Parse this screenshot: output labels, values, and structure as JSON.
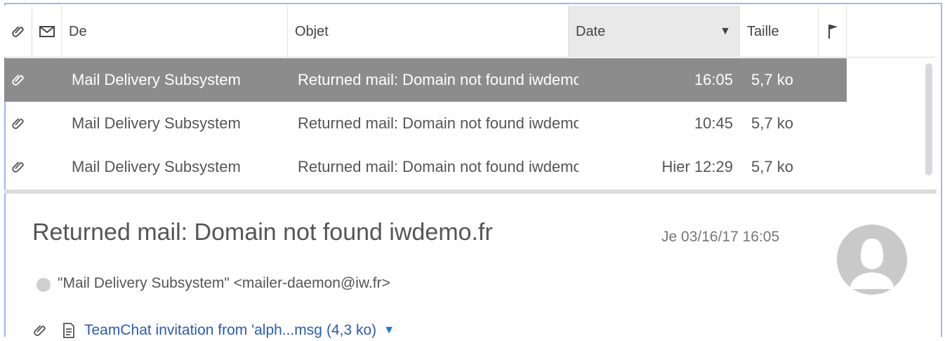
{
  "columns": {
    "from": "De",
    "subject": "Objet",
    "date": "Date",
    "sort_indicator": "▼",
    "size": "Taille"
  },
  "messages": [
    {
      "from": "Mail Delivery Subsystem",
      "subject": "Returned mail: Domain not found iwdemo.fr",
      "date": "16:05",
      "size": "5,7 ko",
      "selected": true,
      "has_attachment": true
    },
    {
      "from": "Mail Delivery Subsystem",
      "subject": "Returned mail: Domain not found iwdemo.fr",
      "date": "10:45",
      "size": "5,7 ko",
      "selected": false,
      "has_attachment": true
    },
    {
      "from": "Mail Delivery Subsystem",
      "subject": "Returned mail: Domain not found iwdemo.fr",
      "date": "Hier 12:29",
      "size": "5,7 ko",
      "selected": false,
      "has_attachment": true
    }
  ],
  "preview": {
    "subject": "Returned mail: Domain not found iwdemo.fr",
    "date": "Je 03/16/17 16:05",
    "sender": "\"Mail Delivery Subsystem\" <mailer-daemon@iw.fr>",
    "attachment": {
      "name": "TeamChat invitation from 'alph...msg",
      "size": "(4,3 ko)",
      "caret": "▼"
    }
  },
  "colors": {
    "selected_row": "#8c8c8c",
    "window_border": "#9db8e8",
    "link": "#2a5bb5"
  },
  "icons": {
    "attachment": "paperclip-icon",
    "read_status": "envelope-icon",
    "flag": "flag-icon",
    "avatar": "user-avatar-icon",
    "document": "document-icon"
  }
}
